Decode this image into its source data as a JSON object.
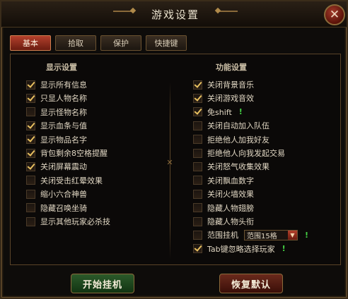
{
  "window": {
    "title": "游戏设置",
    "close_symbol": "✕"
  },
  "tabs": [
    {
      "label": "基本",
      "active": true
    },
    {
      "label": "拾取",
      "active": false
    },
    {
      "label": "保护",
      "active": false
    },
    {
      "label": "快捷键",
      "active": false
    }
  ],
  "display_settings": {
    "title": "显示设置",
    "options": [
      {
        "label": "显示所有信息",
        "checked": true
      },
      {
        "label": "只显人物名称",
        "checked": true
      },
      {
        "label": "显示怪物名称",
        "checked": false
      },
      {
        "label": "显示血条与值",
        "checked": true
      },
      {
        "label": "显示物品名字",
        "checked": true
      },
      {
        "label": "背包剩余8空格提醒",
        "checked": true
      },
      {
        "label": "关闭屏幕震动",
        "checked": true
      },
      {
        "label": "关闭受击红晕效果",
        "checked": false
      },
      {
        "label": "缩小六合神兽",
        "checked": false
      },
      {
        "label": "隐藏召唤坐骑",
        "checked": false
      },
      {
        "label": "显示其他玩家必杀技",
        "checked": false
      }
    ]
  },
  "function_settings": {
    "title": "功能设置",
    "options": [
      {
        "label": "关闭背景音乐",
        "checked": true
      },
      {
        "label": "关闭游戏音效",
        "checked": true
      },
      {
        "label": "免shift",
        "checked": true,
        "badge": "!"
      },
      {
        "label": "关闭自动加入队伍",
        "checked": false
      },
      {
        "label": "拒绝他人加我好友",
        "checked": false
      },
      {
        "label": "拒绝他人向我发起交易",
        "checked": false
      },
      {
        "label": "关闭怒气收集效果",
        "checked": false
      },
      {
        "label": "关闭飘血数字",
        "checked": false
      },
      {
        "label": "关闭火墙效果",
        "checked": false
      },
      {
        "label": "隐藏人物翅膀",
        "checked": false
      },
      {
        "label": "隐藏人物头衔",
        "checked": false
      },
      {
        "label": "范围挂机",
        "checked": false,
        "badge": "!",
        "select_value": "范围15格"
      },
      {
        "label": "Tab键忽略选择玩家",
        "checked": true,
        "badge": "!"
      }
    ]
  },
  "buttons": {
    "start": "开始挂机",
    "reset": "恢复默认"
  },
  "colors": {
    "accent_red": "#b4402c",
    "check": "#e8c060",
    "badge_green": "#44d044"
  }
}
